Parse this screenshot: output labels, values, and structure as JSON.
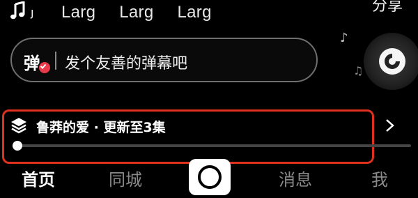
{
  "top": {
    "music_labels": [
      "Larg",
      "Larg",
      "Larg"
    ],
    "share_label": "分享"
  },
  "danmaku": {
    "badge_char": "弹",
    "placeholder": "发个友善的弹幕吧"
  },
  "series": {
    "title": "鲁莽的爱 · 更新至3集",
    "progress": 0
  },
  "nav": {
    "home": "首页",
    "city": "同城",
    "messages": "消息",
    "me": "我"
  },
  "colors": {
    "background": "#000000",
    "highlight": "#e0311f",
    "badge_red": "#e83a4a",
    "inactive_text": "#8a8a8a"
  },
  "icons": {
    "music": "music-note-icon",
    "stack": "stack-layers-icon",
    "chevron": "chevron-right-icon",
    "create": "create-button-icon"
  }
}
